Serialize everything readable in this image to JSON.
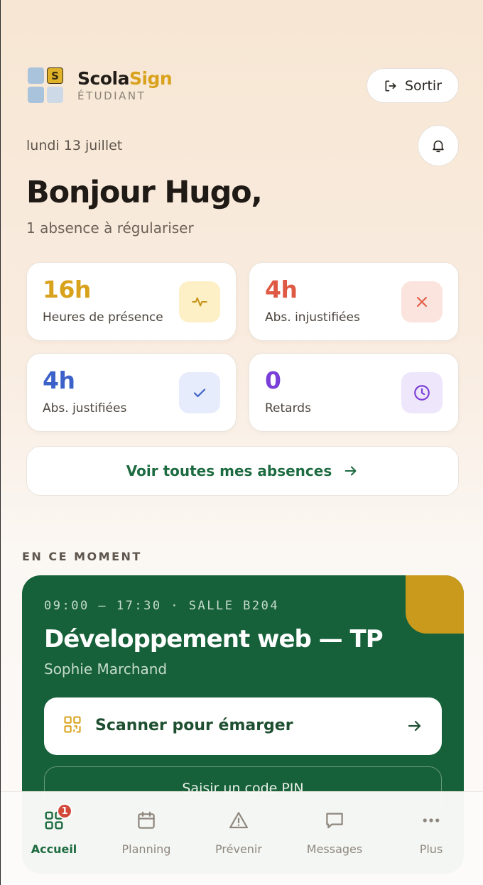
{
  "header": {
    "logo_letter": "S",
    "brand_part1": "Scola",
    "brand_part2": "Sign",
    "brand_sub": "ÉTUDIANT",
    "logout_label": "Sortir"
  },
  "date": "lundi 13 juillet",
  "greeting": "Bonjour Hugo,",
  "subline": "1 absence à régulariser",
  "stats": [
    {
      "value": "16h",
      "label": "Heures de présence",
      "color": "#d9a21c",
      "icon": "pulse-icon",
      "icon_bg": "#fdf0c7"
    },
    {
      "value": "4h",
      "label": "Abs. injustifiées",
      "color": "#df5a44",
      "icon": "close-icon",
      "icon_bg": "#fbe3de"
    },
    {
      "value": "4h",
      "label": "Abs. justifiées",
      "color": "#3c62c9",
      "icon": "check-icon",
      "icon_bg": "#e6ecfb"
    },
    {
      "value": "0",
      "label": "Retards",
      "color": "#7a3fd8",
      "icon": "clock-icon",
      "icon_bg": "#eee6fb"
    }
  ],
  "all_absences_label": "Voir toutes mes absences",
  "section_title": "EN CE MOMENT",
  "current_class": {
    "time": "09:00 — 17:30 · SALLE B204",
    "title": "Développement web — TP",
    "teacher": "Sophie Marchand",
    "scan_label": "Scanner pour émarger",
    "pin_label": "Saisir un code PIN"
  },
  "nav": {
    "items": [
      {
        "label": "Accueil",
        "icon": "grid-icon",
        "active": true,
        "badge": "1"
      },
      {
        "label": "Planning",
        "icon": "calendar-icon",
        "active": false
      },
      {
        "label": "Prévenir",
        "icon": "warning-icon",
        "active": false
      },
      {
        "label": "Messages",
        "icon": "message-icon",
        "active": false
      },
      {
        "label": "Plus",
        "icon": "more-icon",
        "active": false
      }
    ]
  },
  "colors": {
    "accent_green": "#1d6b40",
    "card_green": "#17613a",
    "gold": "#d9a21c"
  }
}
